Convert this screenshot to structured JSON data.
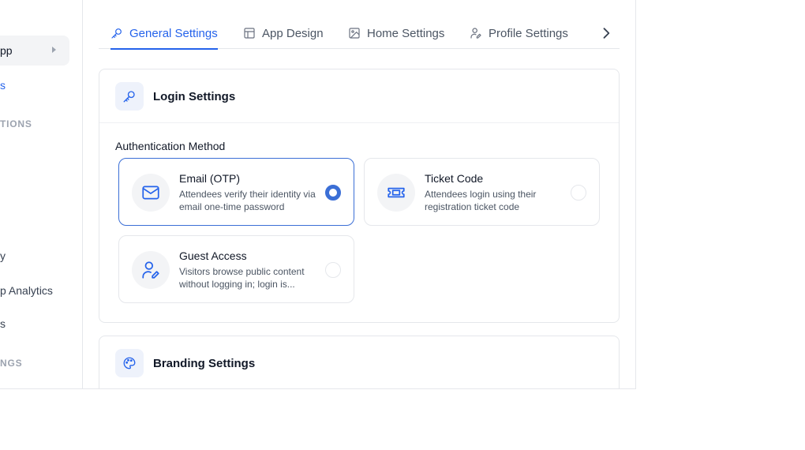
{
  "sidebar": {
    "active_label": "pp",
    "link_partial": "s",
    "section_1": "TIONS",
    "items": [
      "y",
      "p Analytics",
      "s"
    ],
    "section_2": "NGS"
  },
  "tabs": [
    {
      "label": "General Settings",
      "icon": "key-icon",
      "active": true
    },
    {
      "label": "App Design",
      "icon": "layout-icon",
      "active": false
    },
    {
      "label": "Home Settings",
      "icon": "image-icon",
      "active": false
    },
    {
      "label": "Profile Settings",
      "icon": "user-edit-icon",
      "active": false
    }
  ],
  "login_card": {
    "title": "Login Settings",
    "section_label": "Authentication Method",
    "options": [
      {
        "title": "Email (OTP)",
        "desc": "Attendees verify their identity via email one-time password",
        "icon": "mail-icon",
        "selected": true
      },
      {
        "title": "Ticket Code",
        "desc": "Attendees login using their registration ticket code",
        "icon": "ticket-icon",
        "selected": false
      },
      {
        "title": "Guest Access",
        "desc": "Visitors browse public content without logging in; login is...",
        "icon": "user-edit-icon",
        "selected": false
      }
    ]
  },
  "branding_card": {
    "title": "Branding Settings"
  },
  "colors": {
    "accent": "#2563eb",
    "radio_selected": "#3b6fd6",
    "border": "#e5e7eb"
  }
}
